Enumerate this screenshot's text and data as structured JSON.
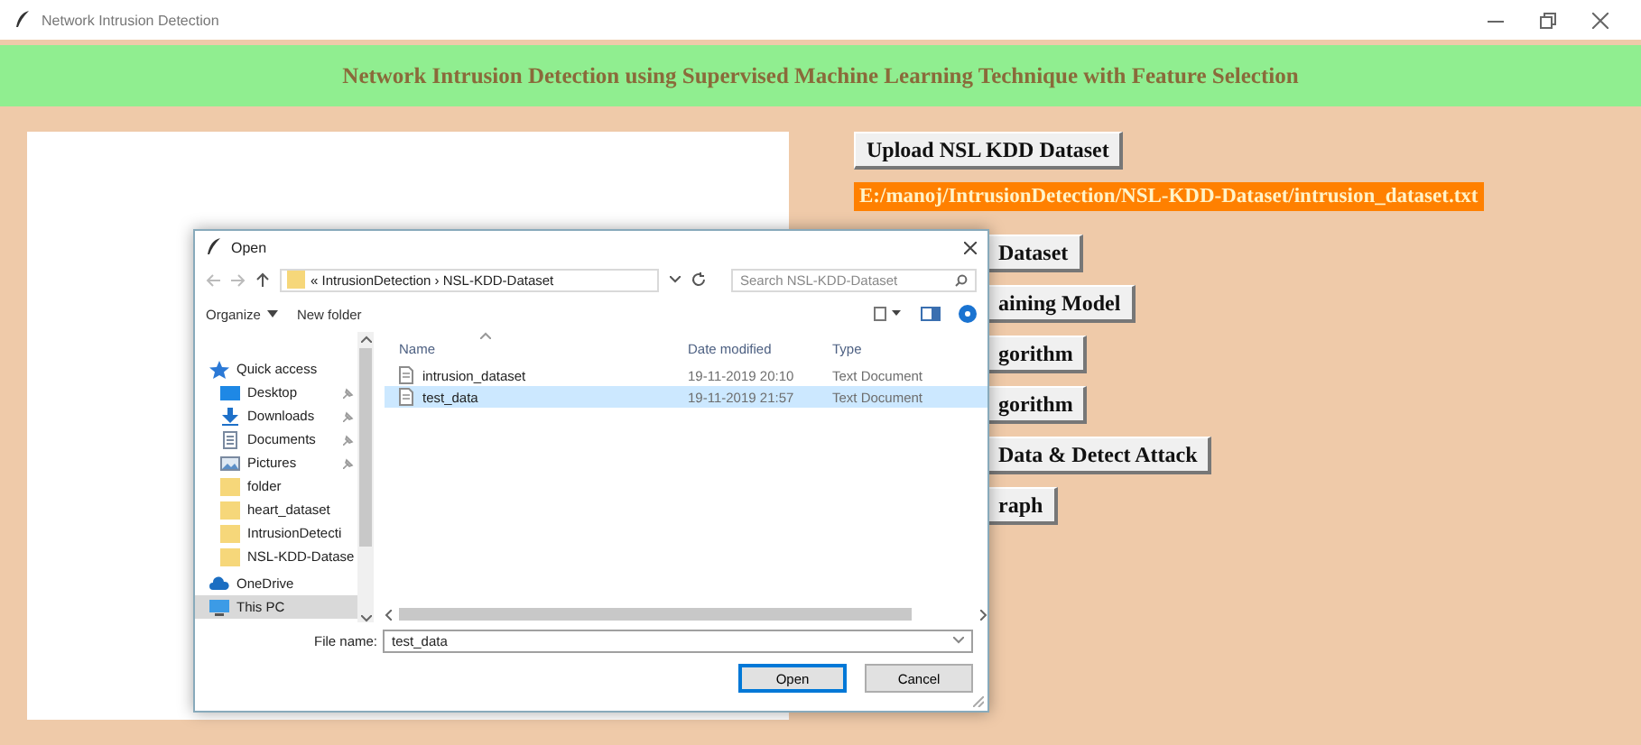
{
  "window": {
    "title": "Network Intrusion Detection"
  },
  "header": {
    "title": "Network Intrusion Detection using Supervised Machine Learning Technique with Feature Selection"
  },
  "actions": [
    {
      "kind": "button",
      "label": "Upload NSL KDD Dataset"
    },
    {
      "kind": "path",
      "label": "E:/manoj/IntrusionDetection/NSL-KDD-Dataset/intrusion_dataset.txt"
    },
    {
      "kind": "button",
      "label": "Dataset"
    },
    {
      "kind": "button",
      "label": "aining Model"
    },
    {
      "kind": "button",
      "label": "gorithm"
    },
    {
      "kind": "button",
      "label": "gorithm"
    },
    {
      "kind": "button",
      "label": "Data & Detect Attack"
    },
    {
      "kind": "button",
      "label": "raph"
    }
  ],
  "dialog": {
    "title": "Open",
    "breadcrumb": "« IntrusionDetection › NSL-KDD-Dataset",
    "search": {
      "placeholder": "Search NSL-KDD-Dataset"
    },
    "toolbar": [
      {
        "label": "Organize",
        "dropdown": true
      },
      {
        "label": "New folder",
        "dropdown": false
      }
    ],
    "nav": [
      {
        "label": "Quick access",
        "kind": "star",
        "pinned": false,
        "selected": false,
        "children": [
          {
            "label": "Desktop",
            "kind": "desktop",
            "pinned": true,
            "selected": false
          },
          {
            "label": "Downloads",
            "kind": "download",
            "pinned": true,
            "selected": false
          },
          {
            "label": "Documents",
            "kind": "document",
            "pinned": true,
            "selected": false
          },
          {
            "label": "Pictures",
            "kind": "picture",
            "pinned": true,
            "selected": false
          },
          {
            "label": "folder",
            "kind": "folder",
            "pinned": false,
            "selected": false
          },
          {
            "label": "heart_dataset",
            "kind": "folder",
            "pinned": false,
            "selected": false
          },
          {
            "label": "IntrusionDetecti",
            "kind": "folder",
            "pinned": false,
            "selected": false
          },
          {
            "label": "NSL-KDD-Datase",
            "kind": "folder",
            "pinned": false,
            "selected": false
          }
        ]
      },
      {
        "label": "OneDrive",
        "kind": "cloud",
        "pinned": false,
        "selected": false
      },
      {
        "label": "This PC",
        "kind": "pc",
        "pinned": false,
        "selected": true
      }
    ],
    "columns": [
      "Name",
      "Date modified",
      "Type"
    ],
    "files": [
      {
        "name": "intrusion_dataset",
        "modified": "19-11-2019 20:10",
        "type": "Text Document",
        "selected": false
      },
      {
        "name": "test_data",
        "modified": "19-11-2019 21:57",
        "type": "Text Document",
        "selected": true
      }
    ],
    "file_name": {
      "label": "File name:",
      "value": "test_data"
    },
    "buttons": [
      {
        "label": "Open",
        "default": true
      },
      {
        "label": "Cancel",
        "default": false
      }
    ]
  }
}
